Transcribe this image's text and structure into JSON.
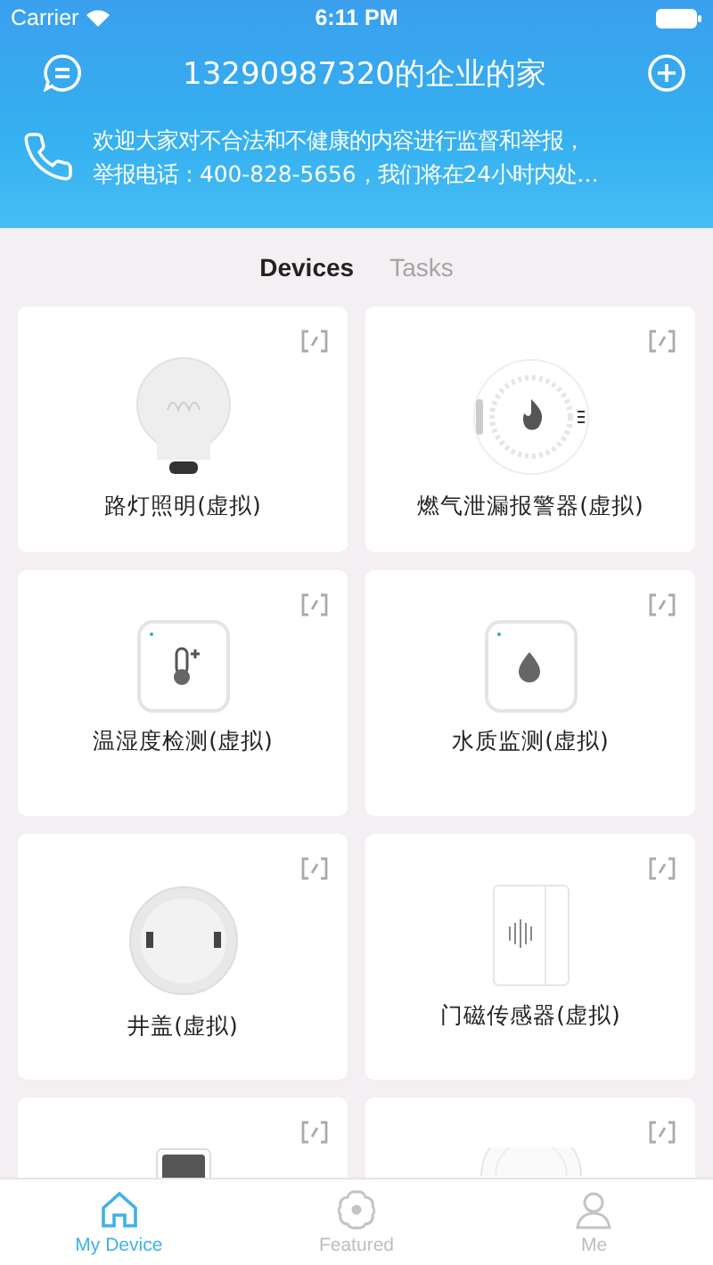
{
  "status_bar": {
    "carrier": "Carrier",
    "time": "6:11 PM"
  },
  "header": {
    "title": "13290987320的企业的家"
  },
  "notice": {
    "lines": [
      "欢迎大家对不合法和不健康的内容进行监督和举报，",
      "举报电话：400-828-5656，我们将在24小时内处…"
    ]
  },
  "tabs": [
    {
      "label": "Devices",
      "selected": true
    },
    {
      "label": "Tasks",
      "selected": false
    }
  ],
  "devices": [
    {
      "name": "路灯照明(虚拟)",
      "kind": "bulb"
    },
    {
      "name": "燃气泄漏报警器(虚拟)",
      "kind": "gas"
    },
    {
      "name": "温湿度检测(虚拟)",
      "kind": "thermo"
    },
    {
      "name": "水质监测(虚拟)",
      "kind": "water"
    },
    {
      "name": "井盖(虚拟)",
      "kind": "manhole"
    },
    {
      "name": "门磁传感器(虚拟)",
      "kind": "door"
    },
    {
      "kind": "panel"
    },
    {
      "kind": "round"
    }
  ],
  "bottom_nav": [
    {
      "label": "My Device",
      "kind": "home",
      "selected": true
    },
    {
      "label": "Featured",
      "kind": "flower",
      "selected": false
    },
    {
      "label": "Me",
      "kind": "person",
      "selected": false
    }
  ]
}
